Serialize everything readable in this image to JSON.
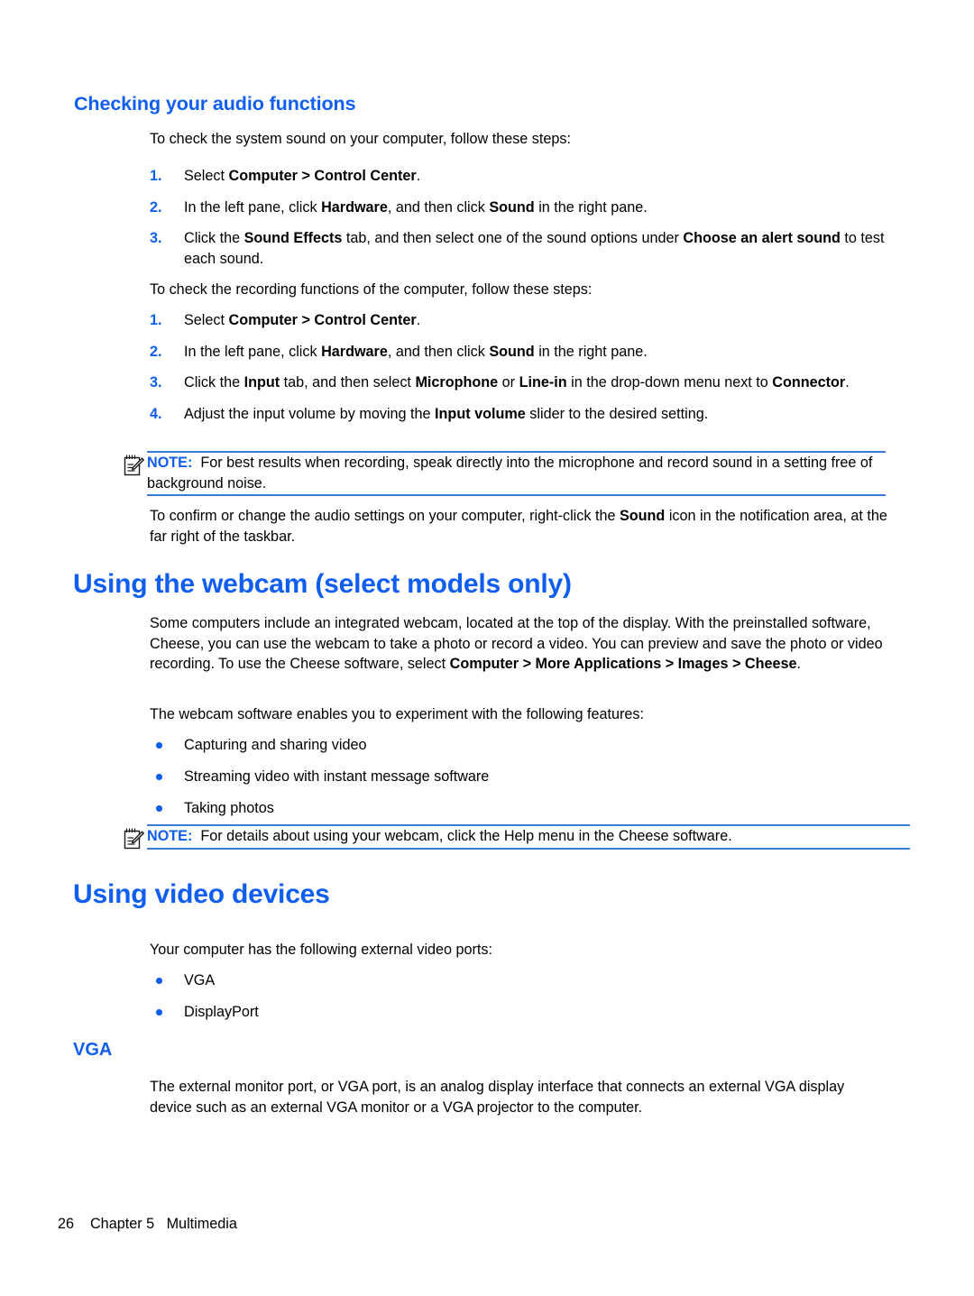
{
  "page": {
    "background": "#ffffff",
    "accent_color": "#0f5ef0",
    "rule_color": "#3a7bd5"
  },
  "sections": {
    "audio": {
      "heading": "Checking your audio functions",
      "intro_system": "To check the system sound on your computer, follow these steps:",
      "steps_system": [
        {
          "num": "1.",
          "parts": [
            {
              "t": "Select ",
              "b": false
            },
            {
              "t": "Computer > Control Center",
              "b": true
            },
            {
              "t": ".",
              "b": false
            }
          ]
        },
        {
          "num": "2.",
          "parts": [
            {
              "t": "In the left pane, click ",
              "b": false
            },
            {
              "t": "Hardware",
              "b": true
            },
            {
              "t": ", and then click ",
              "b": false
            },
            {
              "t": "Sound",
              "b": true
            },
            {
              "t": " in the right pane.",
              "b": false
            }
          ]
        },
        {
          "num": "3.",
          "parts": [
            {
              "t": "Click the ",
              "b": false
            },
            {
              "t": "Sound Effects",
              "b": true
            },
            {
              "t": " tab, and then select one of the sound options under ",
              "b": false
            },
            {
              "t": "Choose an alert sound",
              "b": true
            },
            {
              "t": " to test each sound.",
              "b": false
            }
          ]
        }
      ],
      "intro_recording": "To check the recording functions of the computer, follow these steps:",
      "steps_recording": [
        {
          "num": "1.",
          "parts": [
            {
              "t": "Select ",
              "b": false
            },
            {
              "t": "Computer > Control Center",
              "b": true
            },
            {
              "t": ".",
              "b": false
            }
          ]
        },
        {
          "num": "2.",
          "parts": [
            {
              "t": "In the left pane, click ",
              "b": false
            },
            {
              "t": "Hardware",
              "b": true
            },
            {
              "t": ", and then click ",
              "b": false
            },
            {
              "t": "Sound",
              "b": true
            },
            {
              "t": " in the right pane.",
              "b": false
            }
          ]
        },
        {
          "num": "3.",
          "parts": [
            {
              "t": "Click the ",
              "b": false
            },
            {
              "t": "Input",
              "b": true
            },
            {
              "t": " tab, and then select ",
              "b": false
            },
            {
              "t": "Microphone",
              "b": true
            },
            {
              "t": " or ",
              "b": false
            },
            {
              "t": "Line-in",
              "b": true
            },
            {
              "t": " in the drop-down menu next to ",
              "b": false
            },
            {
              "t": "Connector",
              "b": true
            },
            {
              "t": ".",
              "b": false
            }
          ]
        },
        {
          "num": "4.",
          "parts": [
            {
              "t": "Adjust the input volume by moving the ",
              "b": false
            },
            {
              "t": "Input volume",
              "b": true
            },
            {
              "t": " slider to the desired setting.",
              "b": false
            }
          ]
        }
      ],
      "note": {
        "label": "NOTE:",
        "icon": "note-pad-pencil-icon",
        "text": "For best results when recording, speak directly into the microphone and record sound in a setting free of background noise."
      },
      "closing": {
        "parts": [
          {
            "t": "To confirm or change the audio settings on your computer, right-click the ",
            "b": false
          },
          {
            "t": "Sound",
            "b": true
          },
          {
            "t": " icon in the notification area, at the far right of the taskbar.",
            "b": false
          }
        ]
      }
    },
    "webcam": {
      "heading": "Using the webcam (select models only)",
      "intro": {
        "parts": [
          {
            "t": "Some computers include an integrated webcam, located at the top of the display. With the preinstalled software, Cheese, you can use the webcam to take a photo or record a video. You can preview and save the photo or video recording. To use the Cheese software, select ",
            "b": false
          },
          {
            "t": "Computer > More Applications > Images > Cheese",
            "b": true
          },
          {
            "t": ".",
            "b": false
          }
        ]
      },
      "features_intro": "The webcam software enables you to experiment with the following features:",
      "features": [
        "Capturing and sharing video",
        "Streaming video with instant message software",
        "Taking photos"
      ],
      "note": {
        "label": "NOTE:",
        "icon": "note-pad-pencil-icon",
        "text": "For details about using your webcam, click the Help menu in the Cheese software."
      }
    },
    "video_devices": {
      "heading": "Using video devices",
      "intro": "Your computer has the following external video ports:",
      "ports": [
        "VGA",
        "DisplayPort"
      ],
      "vga": {
        "heading": "VGA",
        "text": "The external monitor port, or VGA port, is an analog display interface that connects an external VGA display device such as an external VGA monitor or a VGA projector to the computer."
      }
    }
  },
  "footer": {
    "page_number": "26",
    "chapter": "Chapter 5",
    "chapter_title": "Multimedia",
    "full": "26    Chapter 5   Multimedia"
  }
}
